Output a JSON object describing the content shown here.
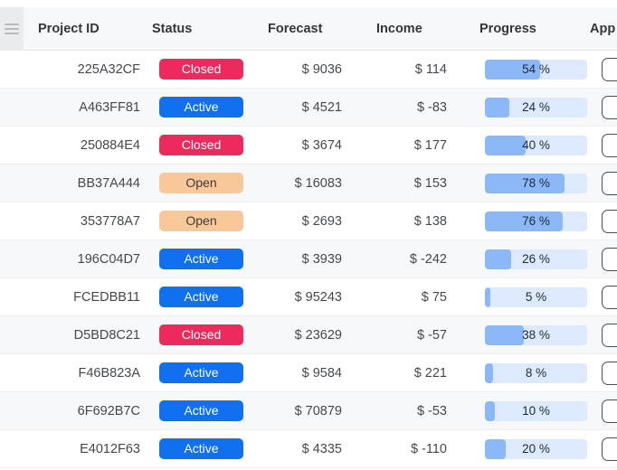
{
  "table": {
    "menu_icon": "hamburger-menu-icon",
    "columns": [
      {
        "key": "project_id",
        "label": "Project ID"
      },
      {
        "key": "status",
        "label": "Status"
      },
      {
        "key": "forecast",
        "label": "Forecast"
      },
      {
        "key": "income",
        "label": "Income"
      },
      {
        "key": "progress",
        "label": "Progress"
      },
      {
        "key": "approve",
        "label": "App"
      }
    ],
    "rows": [
      {
        "project_id": "225A32CF",
        "status": "Closed",
        "forecast": "$ 9036",
        "income": "$ 114",
        "progress": 54,
        "progress_label": "54 %"
      },
      {
        "project_id": "A463FF81",
        "status": "Active",
        "forecast": "$ 4521",
        "income": "$ -83",
        "progress": 24,
        "progress_label": "24 %"
      },
      {
        "project_id": "250884E4",
        "status": "Closed",
        "forecast": "$ 3674",
        "income": "$ 177",
        "progress": 40,
        "progress_label": "40 %"
      },
      {
        "project_id": "BB37A444",
        "status": "Open",
        "forecast": "$ 16083",
        "income": "$ 153",
        "progress": 78,
        "progress_label": "78 %"
      },
      {
        "project_id": "353778A7",
        "status": "Open",
        "forecast": "$ 2693",
        "income": "$ 138",
        "progress": 76,
        "progress_label": "76 %"
      },
      {
        "project_id": "196C04D7",
        "status": "Active",
        "forecast": "$ 3939",
        "income": "$ -242",
        "progress": 26,
        "progress_label": "26 %"
      },
      {
        "project_id": "FCEDBB11",
        "status": "Active",
        "forecast": "$ 95243",
        "income": "$ 75",
        "progress": 5,
        "progress_label": "5 %"
      },
      {
        "project_id": "D5BD8C21",
        "status": "Closed",
        "forecast": "$ 23629",
        "income": "$ -57",
        "progress": 38,
        "progress_label": "38 %"
      },
      {
        "project_id": "F46B823A",
        "status": "Active",
        "forecast": "$ 9584",
        "income": "$ 221",
        "progress": 8,
        "progress_label": "8 %"
      },
      {
        "project_id": "6F692B7C",
        "status": "Active",
        "forecast": "$ 70879",
        "income": "$ -53",
        "progress": 10,
        "progress_label": "10 %"
      },
      {
        "project_id": "E4012F63",
        "status": "Active",
        "forecast": "$ 4335",
        "income": "$ -110",
        "progress": 20,
        "progress_label": "20 %"
      }
    ]
  },
  "colors": {
    "status_closed_bg": "#ec2a5e",
    "status_closed_fg": "#ffffff",
    "status_active_bg": "#1070f0",
    "status_active_fg": "#ffffff",
    "status_open_bg": "#f8c79a",
    "status_open_fg": "#3f3a36",
    "progress_track": "#ddeafd",
    "progress_fill": "#8cb8f7",
    "header_bg": "#f7f8fa",
    "row_alt_bg": "#f7f8fa",
    "menu_cell_bg": "#eaecee"
  }
}
